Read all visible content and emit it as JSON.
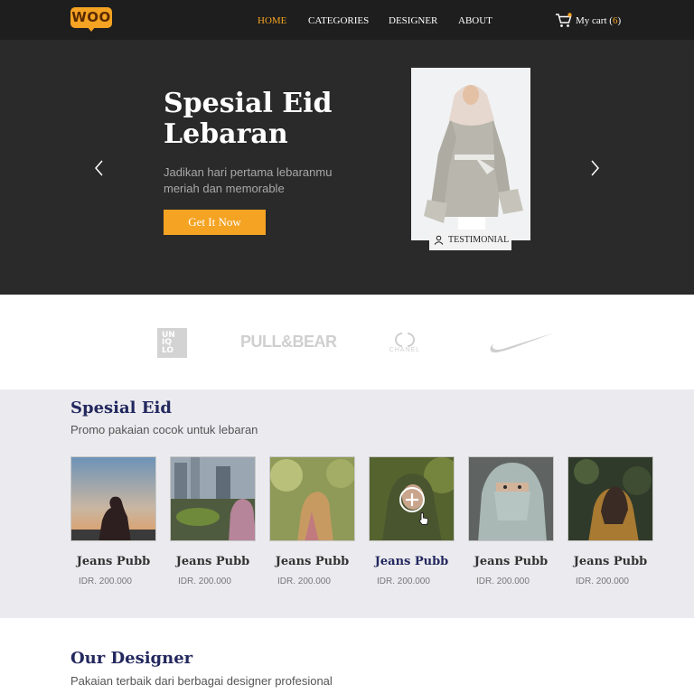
{
  "brand": {
    "logo_text": "WOO",
    "accent": "#f4a322",
    "dark": "#1e1e1e",
    "navy": "#23285e"
  },
  "nav": {
    "items": [
      {
        "label": "HOME",
        "active": true
      },
      {
        "label": "CATEGORIES",
        "active": false
      },
      {
        "label": "DESIGNER",
        "active": false
      },
      {
        "label": "ABOUT",
        "active": false
      }
    ],
    "cart": {
      "label": "My cart",
      "count": "6",
      "open": "(",
      "close": ")"
    }
  },
  "hero": {
    "title": "Spesial Eid Lebaran",
    "subtitle": "Jadikan hari pertama lebaranmu meriah dan memorable",
    "button": "Get It Now",
    "badge": "TESTIMONIAL",
    "prev_icon": "chevron-left-icon",
    "next_icon": "chevron-right-icon"
  },
  "brands": [
    {
      "name": "UNIQLO",
      "lines": [
        "UN",
        "IQ",
        "LO"
      ]
    },
    {
      "name": "PULL&BEAR"
    },
    {
      "name": "CHANEL"
    },
    {
      "name": "NIKE"
    }
  ],
  "spesial": {
    "title": "Spesial Eid",
    "subtitle": "Promo pakaian cocok untuk lebaran",
    "products": [
      {
        "name": "Jeans Pubb",
        "price": "IDR. 200.000"
      },
      {
        "name": "Jeans Pubb",
        "price": "IDR. 200.000"
      },
      {
        "name": "Jeans Pubb",
        "price": "IDR. 200.000"
      },
      {
        "name": "Jeans Pubb",
        "price": "IDR. 200.000",
        "hover": true
      },
      {
        "name": "Jeans Pubb",
        "price": "IDR. 200.000"
      },
      {
        "name": "Jeans Pubb",
        "price": "IDR. 200.000"
      }
    ]
  },
  "designer": {
    "title": "Our Designer",
    "subtitle": "Pakaian terbaik dari berbagai designer profesional"
  }
}
